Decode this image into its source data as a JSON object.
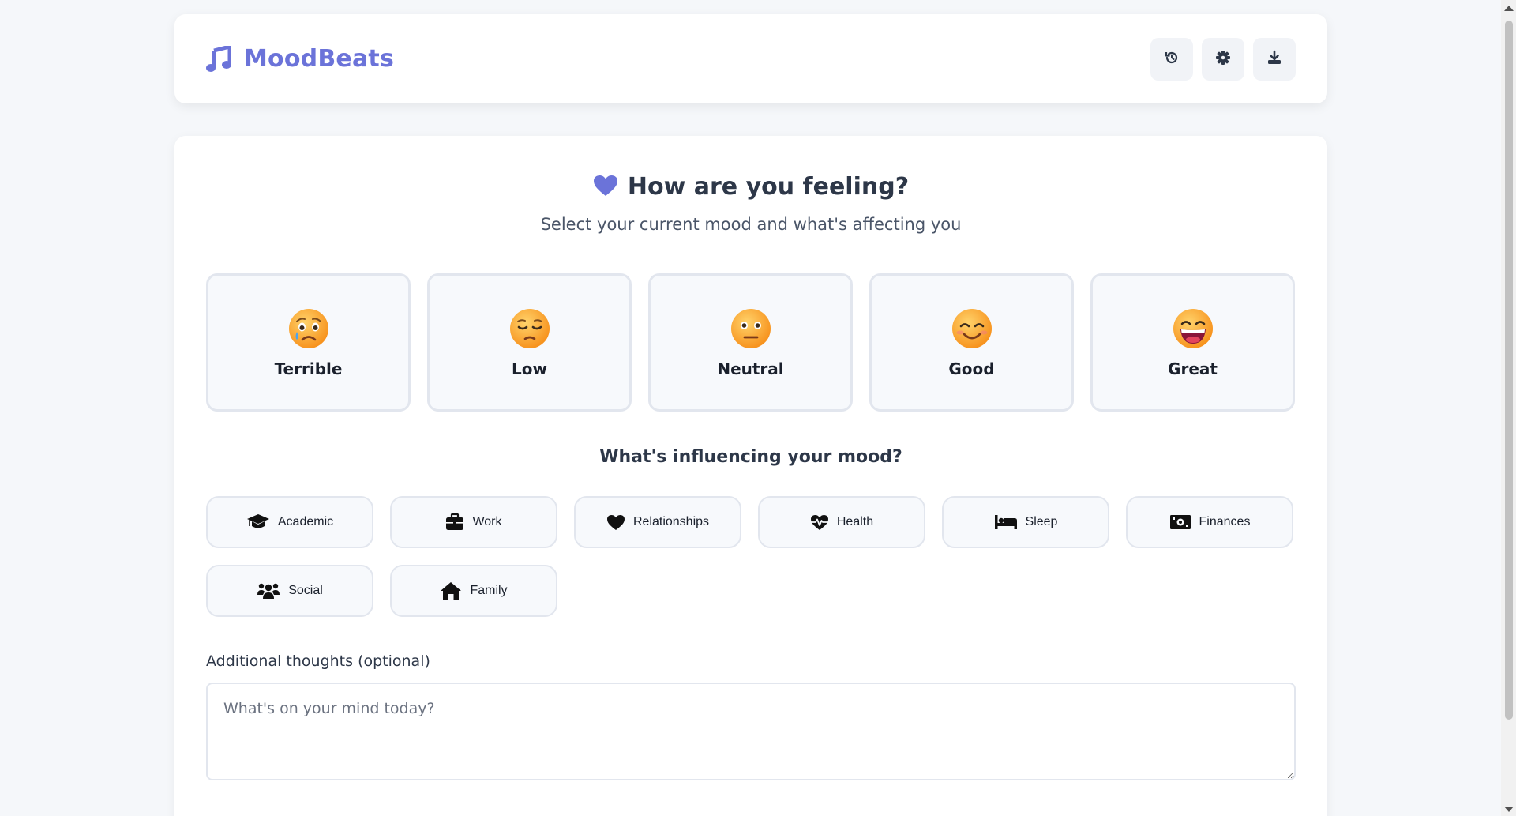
{
  "app": {
    "name": "MoodBeats",
    "brand_color": "#6b73d9"
  },
  "header": {
    "actions": [
      {
        "icon": "history-icon",
        "name": "history-button"
      },
      {
        "icon": "gear-icon",
        "name": "settings-button"
      },
      {
        "icon": "download-icon",
        "name": "export-button"
      }
    ]
  },
  "main": {
    "title": "How are you feeling?",
    "title_icon": "heart-icon",
    "subtitle": "Select your current mood and what's affecting you",
    "moods": [
      {
        "label": "Terrible",
        "icon": "crying-face-icon"
      },
      {
        "label": "Low",
        "icon": "pensive-face-icon"
      },
      {
        "label": "Neutral",
        "icon": "neutral-face-icon"
      },
      {
        "label": "Good",
        "icon": "smiling-face-icon"
      },
      {
        "label": "Great",
        "icon": "grinning-face-icon"
      }
    ],
    "factors_title": "What's influencing your mood?",
    "factors": [
      {
        "label": "Academic",
        "icon": "graduation-cap-icon"
      },
      {
        "label": "Work",
        "icon": "briefcase-icon"
      },
      {
        "label": "Relationships",
        "icon": "heart-icon"
      },
      {
        "label": "Health",
        "icon": "heartbeat-icon"
      },
      {
        "label": "Sleep",
        "icon": "bed-icon"
      },
      {
        "label": "Finances",
        "icon": "money-bill-icon"
      },
      {
        "label": "Social",
        "icon": "users-icon"
      },
      {
        "label": "Family",
        "icon": "home-icon"
      }
    ],
    "notes": {
      "label": "Additional thoughts (optional)",
      "placeholder": "What's on your mind today?",
      "value": ""
    }
  }
}
